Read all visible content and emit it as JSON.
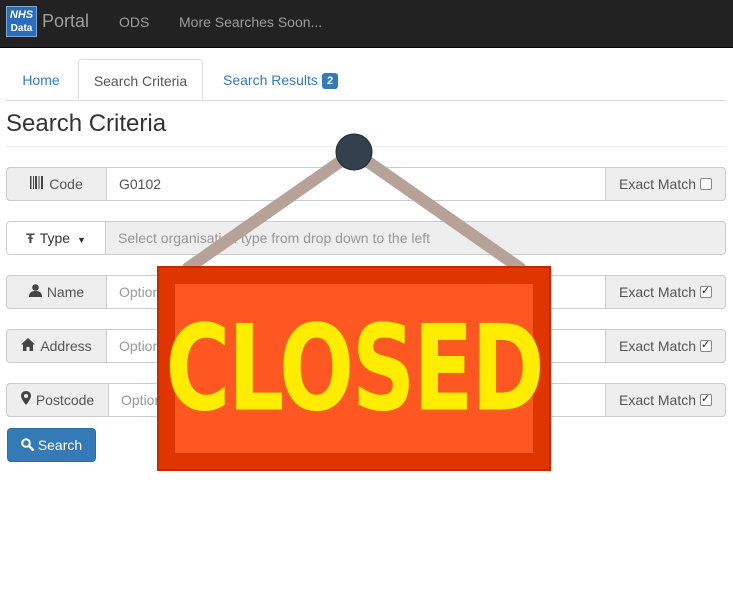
{
  "navbar": {
    "logo_line1": "NHS",
    "logo_line2": "Data",
    "brand": "Portal",
    "links": [
      "ODS",
      "More Searches Soon..."
    ]
  },
  "tabs": {
    "home": "Home",
    "criteria": "Search Criteria",
    "results": "Search Results",
    "results_count": "2"
  },
  "page_title": "Search Criteria",
  "form": {
    "code": {
      "label": "Code",
      "value": "G0102",
      "exact_label": "Exact Match",
      "exact_checked": false
    },
    "type": {
      "label": "Type",
      "placeholder": "Select organisation type from drop down to the left"
    },
    "name": {
      "label": "Name",
      "placeholder": "Optional",
      "exact_label": "Exact Match",
      "exact_checked": true
    },
    "address": {
      "label": "Address",
      "placeholder": "Optional",
      "exact_label": "Exact Match",
      "exact_checked": true
    },
    "postcode": {
      "label": "Postcode",
      "placeholder": "Optional",
      "exact_label": "Exact Match",
      "exact_checked": true
    },
    "search_button": "Search"
  },
  "sign": {
    "text": "CLOSED"
  },
  "colors": {
    "primary": "#337ab7",
    "navbar": "#222222",
    "sign_board": "#e03500",
    "sign_text": "#ffec00"
  }
}
